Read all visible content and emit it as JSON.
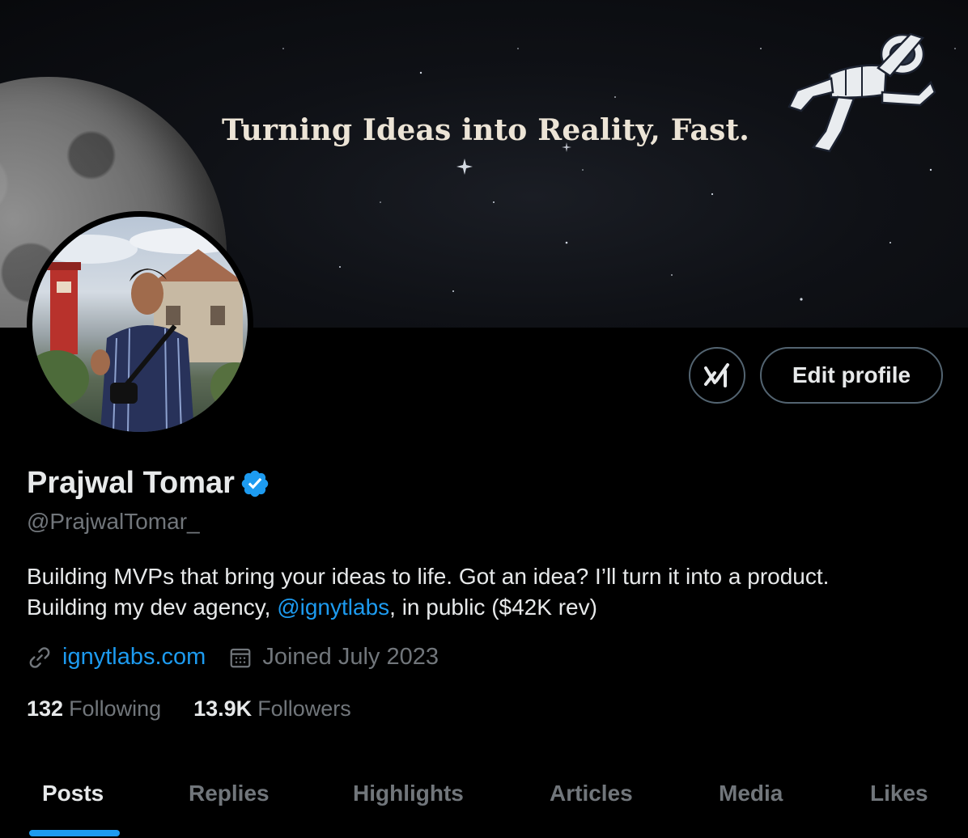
{
  "banner": {
    "tagline": "Turning Ideas into Reality, Fast."
  },
  "profile": {
    "name": "Prajwal Tomar",
    "handle": "@PrajwalTomar_",
    "bio_line1": "Building MVPs that bring your ideas to life. Got an idea? I’ll turn it into a product.",
    "bio_line2_prefix": "Building my dev agency, ",
    "bio_mention": "@ignytlabs",
    "bio_line2_suffix": ", in public ($42K rev)",
    "website": "ignytlabs.com",
    "joined": "Joined July 2023",
    "following_count": "132",
    "following_label": "Following",
    "followers_count": "13.9K",
    "followers_label": "Followers"
  },
  "actions": {
    "edit_profile": "Edit profile",
    "grok_icon": "grok-icon"
  },
  "tabs": [
    {
      "label": "Posts",
      "active": true
    },
    {
      "label": "Replies",
      "active": false
    },
    {
      "label": "Highlights",
      "active": false
    },
    {
      "label": "Articles",
      "active": false
    },
    {
      "label": "Media",
      "active": false
    },
    {
      "label": "Likes",
      "active": false
    }
  ],
  "colors": {
    "accent": "#1d9bf0",
    "muted": "#71767b",
    "text": "#e7e9ea",
    "background": "#000000"
  }
}
